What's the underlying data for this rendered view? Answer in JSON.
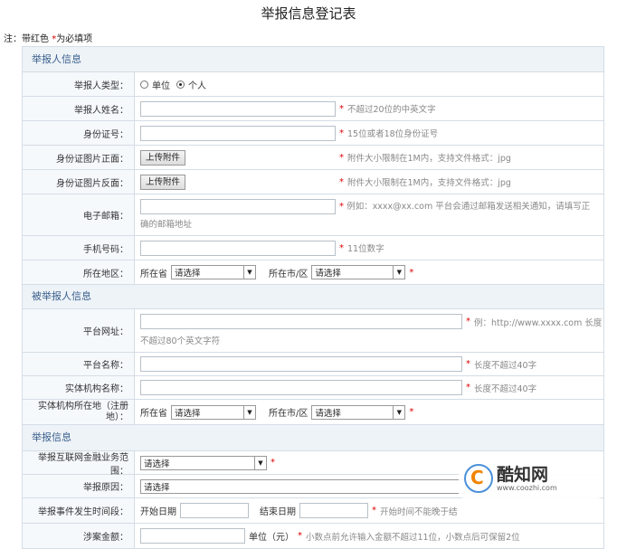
{
  "title": "举报信息登记表",
  "note": {
    "prefix": "注：带红色 ",
    "star": "*",
    "suffix": "为必填项"
  },
  "sections": {
    "reporter": "举报人信息",
    "reported": "被举报人信息",
    "report": "举报信息"
  },
  "reporter": {
    "type_label": "举报人类型：",
    "type_options": [
      "单位",
      "个人"
    ],
    "type_selected": "个人",
    "name_label": "举报人姓名：",
    "name_hint": "不超过20位的中英文字",
    "id_label": "身份证号：",
    "id_hint": "15位或者18位身份证号",
    "id_front_label": "身份证图片正面：",
    "id_back_label": "身份证图片反面：",
    "upload_button": "上传附件",
    "upload_hint": "附件大小限制在1M内，支持文件格式：jpg",
    "email_label": "电子邮箱：",
    "email_hint_1": "例如：xxxx@xx.com 平台会通过邮箱发送相关通知，请填写正",
    "email_hint_2": "确的邮箱地址",
    "phone_label": "手机号码：",
    "phone_hint": "11位数字",
    "region_label": "所在地区：",
    "province_label": "所在省",
    "city_label": "所在市/区",
    "select_placeholder": "请选择"
  },
  "reported": {
    "url_label": "平台网址：",
    "url_hint_1": "例：http://www.xxxx.com 长度",
    "url_hint_2": "不超过80个英文字符",
    "name_label": "平台名称：",
    "name_hint": "长度不超过40字",
    "entity_label": "实体机构名称：",
    "entity_hint": "长度不超过40字",
    "entity_region_label": "实体机构所在地（注册地）：",
    "province_label": "所在省",
    "city_label": "所在市/区",
    "select_placeholder": "请选择"
  },
  "report": {
    "scope_label": "举报互联网金融业务范围：",
    "scope_value": "请选择",
    "reason_label": "举报原因：",
    "reason_value": "请选择",
    "period_label": "举报事件发生时间段：",
    "start_label": "开始日期",
    "end_label": "结束日期",
    "period_hint": "开始时间不能晚于结",
    "amount_label": "涉案金额：",
    "amount_unit": "单位（元）",
    "amount_hint": "小数点前允许输入金额不超过11位，小数点后可保留2位"
  },
  "watermark": {
    "name": "酷知网",
    "url": "www.coozhi.com"
  },
  "colors": {
    "required": "#dd0000",
    "section_text": "#3a5f8c",
    "section_bg": "#eef3f8",
    "border": "#d4dde6"
  }
}
